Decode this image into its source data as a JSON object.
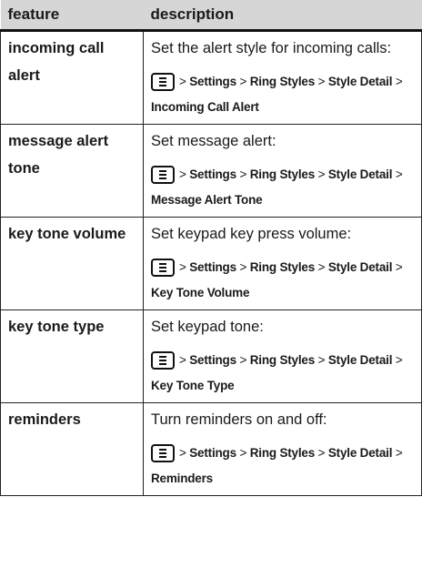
{
  "table": {
    "headers": {
      "feature": "feature",
      "description": "description"
    },
    "icon": "menu-key-icon",
    "sep": ">",
    "rows": [
      {
        "feature": "incoming call alert",
        "description": "Set the alert style for incoming calls:",
        "path": [
          "Settings",
          "Ring Styles",
          "Style Detail",
          "Incoming Call Alert"
        ]
      },
      {
        "feature": "message alert tone",
        "description": "Set message alert:",
        "path": [
          "Settings",
          "Ring Styles",
          "Style Detail",
          "Message Alert Tone"
        ]
      },
      {
        "feature": "key tone volume",
        "description": "Set keypad key press volume:",
        "path": [
          "Settings",
          "Ring Styles",
          "Style Detail",
          "Key Tone Volume"
        ]
      },
      {
        "feature": "key tone type",
        "description": "Set keypad tone:",
        "path": [
          "Settings",
          "Ring Styles",
          "Style Detail",
          "Key Tone Type"
        ]
      },
      {
        "feature": "reminders",
        "description": "Turn reminders on and off:",
        "path": [
          "Settings",
          "Ring Styles",
          "Style Detail",
          "Reminders"
        ]
      }
    ]
  }
}
